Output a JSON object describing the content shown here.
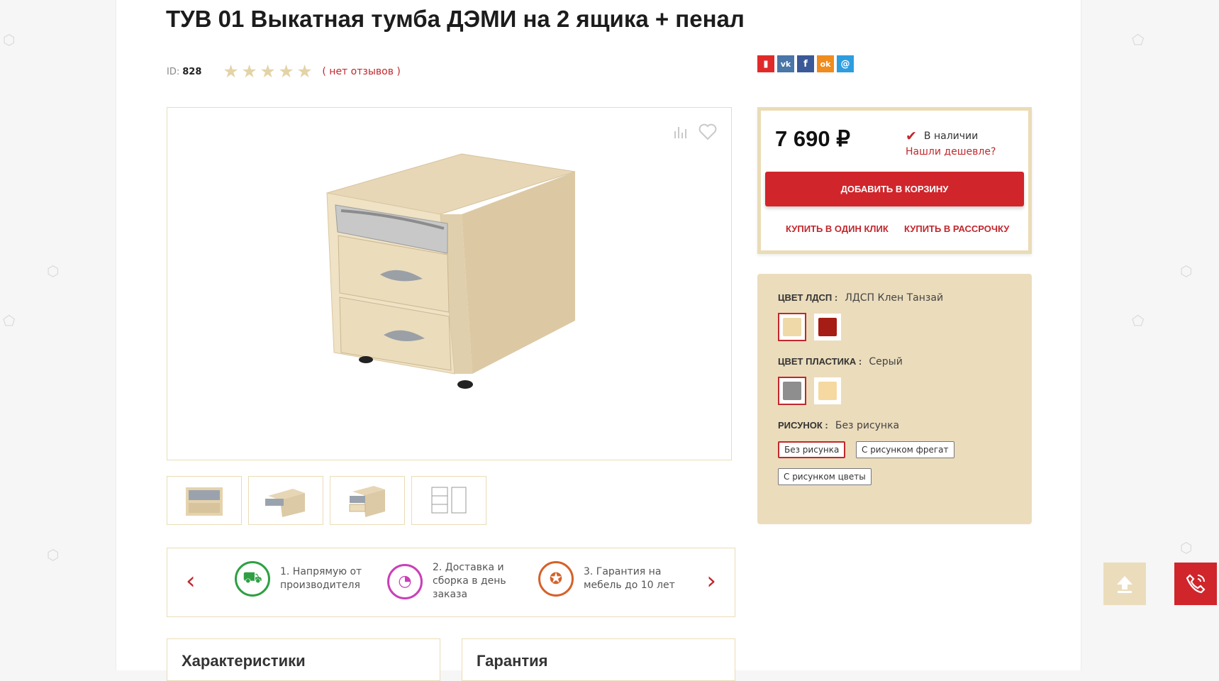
{
  "product": {
    "title": "ТУВ 01 Выкатная тумба ДЭМИ на 2 ящика + пенал",
    "id_label": "ID:",
    "id_value": "828",
    "rating": 0,
    "rating_max": 5,
    "reviews": "( нет отзывов )"
  },
  "share": [
    {
      "icon": "bookmark-icon",
      "glyph": "▮",
      "color": "#e02a2a"
    },
    {
      "icon": "vk-icon",
      "glyph": "vk",
      "color": "#4a76a8"
    },
    {
      "icon": "facebook-icon",
      "glyph": "f",
      "color": "#3b5998"
    },
    {
      "icon": "odnoklassniki-icon",
      "glyph": "ok",
      "color": "#f08c1e"
    },
    {
      "icon": "moimir-icon",
      "glyph": "@",
      "color": "#2d9de0"
    }
  ],
  "buy": {
    "price": "7 690 ₽",
    "stock": "В наличии",
    "cheaper": "Нашли дешевле?",
    "add_to_cart": "ДОБАВИТЬ В КОРЗИНУ",
    "one_click": "КУПИТЬ В ОДИН КЛИК",
    "installment": "КУПИТЬ В РАССРОЧКУ"
  },
  "options": {
    "ldsp": {
      "label": "ЦВЕТ ЛДСП :",
      "value": "ЛДСП Клен Танзай",
      "swatches": [
        "#f0d9a8",
        "#a51d14"
      ]
    },
    "plastic": {
      "label": "ЦВЕТ ПЛАСТИКА :",
      "value": "Серый",
      "swatches": [
        "#8e8e8e",
        "#f5d9a0"
      ]
    },
    "pattern": {
      "label": "РИСУНОК :",
      "value": "Без рисунка",
      "choices": [
        "Без рисунка",
        "С рисунком фрегат",
        "С рисунком цветы"
      ]
    }
  },
  "benefits": [
    {
      "text": "1. Напрямую от производителя",
      "color": "#2ea043",
      "icon": "truck-icon"
    },
    {
      "text": "2. Доставка и сборка в день заказа",
      "color": "#c940b8",
      "icon": "clock-icon"
    },
    {
      "text": "3. Гарантия на мебель до 10 лет",
      "color": "#d4622a",
      "icon": "award-icon"
    }
  ],
  "sections": {
    "specs": "Характеристики",
    "warranty": "Гарантия"
  }
}
